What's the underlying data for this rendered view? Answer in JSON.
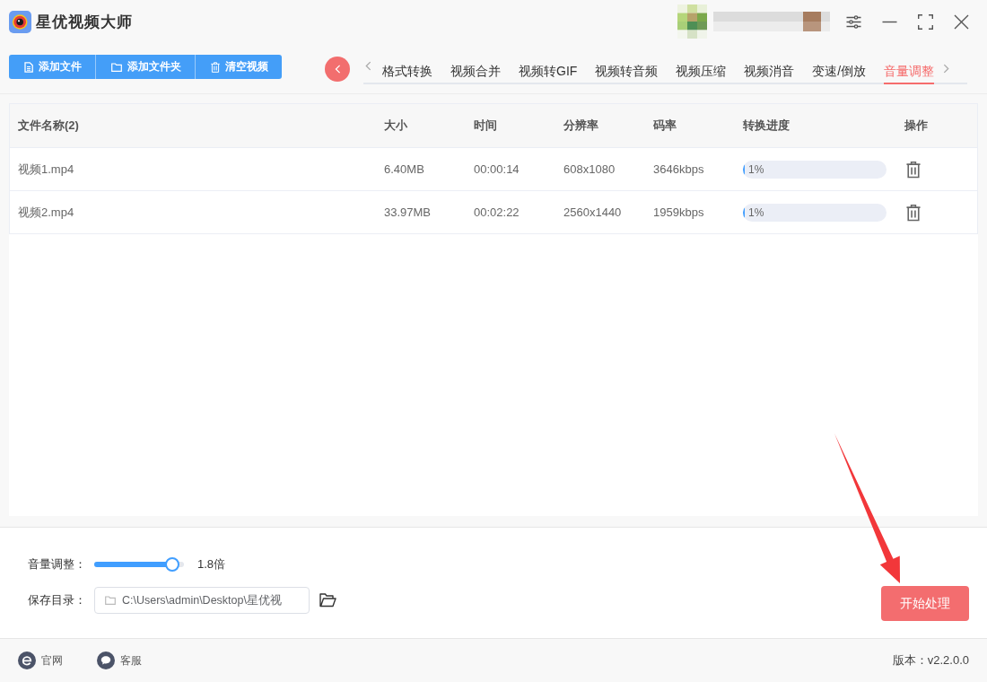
{
  "window": {
    "title": "星优视频大师"
  },
  "toolbar": {
    "buttons": [
      {
        "label": "添加文件",
        "kind": "file"
      },
      {
        "label": "添加文件夹",
        "kind": "folder"
      },
      {
        "label": "清空视频",
        "kind": "clear"
      }
    ]
  },
  "tabs": [
    {
      "label": "格式转换",
      "selected": false
    },
    {
      "label": "视频合并",
      "selected": false
    },
    {
      "label": "视频转GIF",
      "selected": false
    },
    {
      "label": "视频转音频",
      "selected": false
    },
    {
      "label": "视频压缩",
      "selected": false
    },
    {
      "label": "视频消音",
      "selected": false
    },
    {
      "label": "变速/倒放",
      "selected": false
    },
    {
      "label": "音量调整",
      "selected": true
    }
  ],
  "table": {
    "columns": [
      "文件名称(2)",
      "大小",
      "时间",
      "分辨率",
      "码率",
      "转换进度",
      "操作"
    ],
    "rows": [
      {
        "name": "视频1.mp4",
        "size": "6.40MB",
        "duration": "00:00:14",
        "resolution": "608x1080",
        "bitrate": "3646kbps",
        "progress": {
          "level": 0.01,
          "reading": "1%"
        }
      },
      {
        "name": "视频2.mp4",
        "size": "33.97MB",
        "duration": "00:02:22",
        "resolution": "2560x1440",
        "bitrate": "1959kbps",
        "progress": {
          "level": 0.01,
          "reading": "1%"
        }
      }
    ]
  },
  "settings": {
    "volume": {
      "label": "音量调整：",
      "level": 0.87,
      "reading": "1.8倍"
    },
    "output_folder": {
      "label": "保存目录：",
      "value": "C:\\Users\\admin\\Desktop\\星优视"
    }
  },
  "start_button": {
    "label": "开始处理"
  },
  "footer": {
    "links": [
      {
        "label": "官网",
        "kind": "website"
      },
      {
        "label": "客服",
        "kind": "support"
      }
    ],
    "version": "版本：v2.2.0.0"
  }
}
